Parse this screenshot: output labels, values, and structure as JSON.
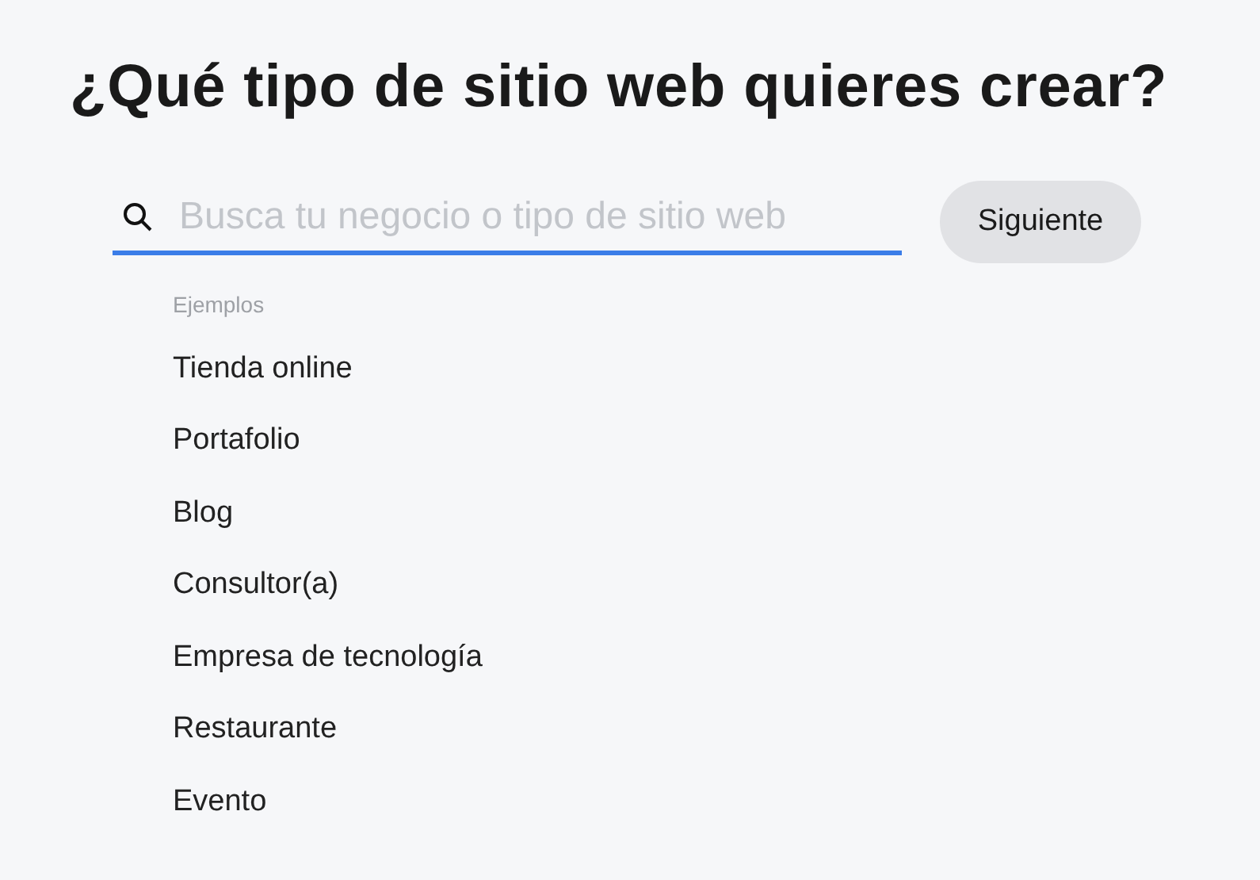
{
  "heading": "¿Qué tipo de sitio web quieres crear?",
  "search": {
    "placeholder": "Busca tu negocio o tipo de sitio web"
  },
  "next_button": "Siguiente",
  "examples": {
    "label": "Ejemplos",
    "items": [
      "Tienda online",
      "Portafolio",
      "Blog",
      "Consultor(a)",
      "Empresa de tecnología",
      "Restaurante",
      "Evento"
    ]
  }
}
